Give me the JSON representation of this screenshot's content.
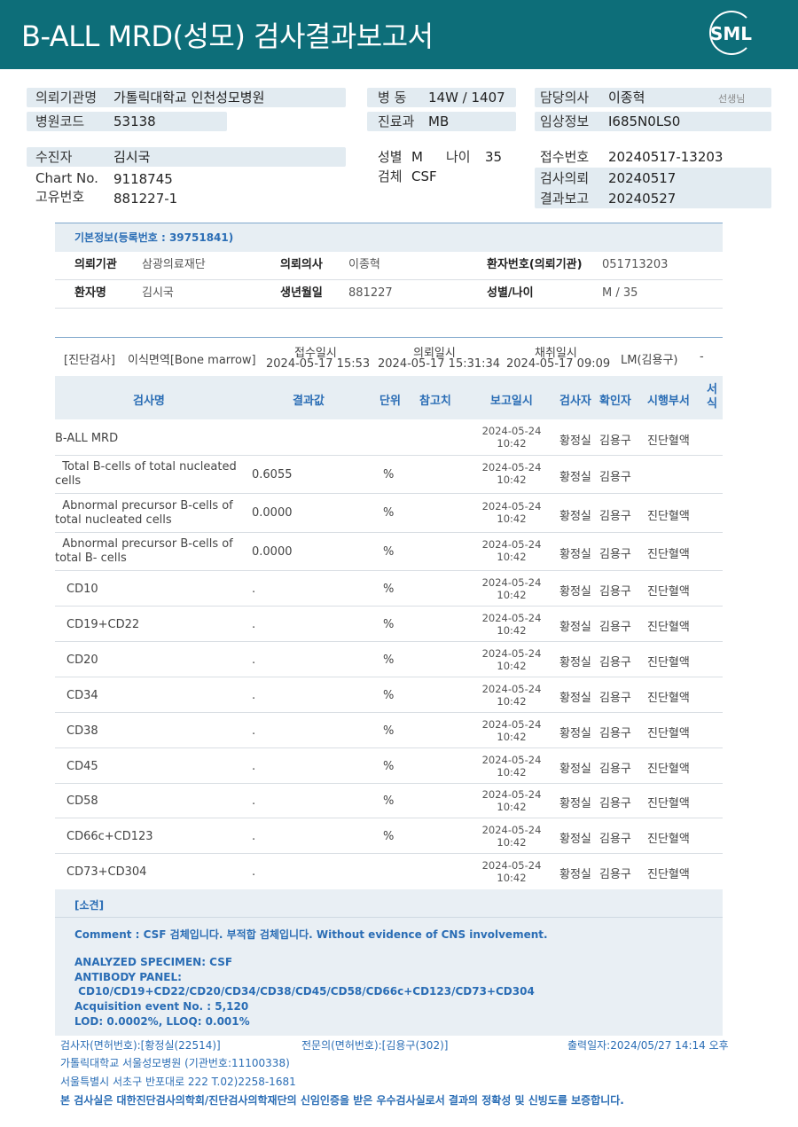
{
  "header": {
    "title": "B-ALL  MRD(성모) 검사결과보고서",
    "logo_text": "SML"
  },
  "request": {
    "institution_label": "의뢰기관명",
    "institution_value": "가톨릭대학교 인천성모병원",
    "hospital_code_label": "병원코드",
    "hospital_code_value": "53138",
    "ward_label": "병  동",
    "ward_value": "14W / 1407",
    "dept_label": "진료과",
    "dept_value": "MB",
    "doctor_label": "담당의사",
    "doctor_value": "이종혁",
    "doctor_suffix": "선생님",
    "clinical_label": "임상정보",
    "clinical_value": "I685N0LS0",
    "patient_label": "수진자",
    "patient_value": "김시국",
    "chart_label": "Chart No.",
    "chart_value": "9118745",
    "unique_label": "고유번호",
    "unique_value": "881227-1",
    "sex_label": "성별",
    "sex_value": "M",
    "age_label": "나이",
    "age_value": "35",
    "specimen_label": "검체",
    "specimen_value": "CSF",
    "receipt_label": "접수번호",
    "receipt_value": "20240517-13203",
    "request_date_label": "검사의뢰",
    "request_date_value": "20240517",
    "report_date_label": "결과보고",
    "report_date_value": "20240527"
  },
  "basic": {
    "title": "기본정보(등록번호 : 39751841)",
    "r1": {
      "l1": "의뢰기관",
      "v1": "삼광의료재단",
      "l2": "의뢰의사",
      "v2": "이종혁",
      "l3": "환자번호(의뢰기관)",
      "v3": "051713203"
    },
    "r2": {
      "l1": "환자명",
      "v1": "김시국",
      "l2": "생년월일",
      "v2": "881227",
      "l3": "성별/나이",
      "v3": "M / 35"
    }
  },
  "diag": {
    "category": "[진단검사]",
    "name": "이식면역[Bone marrow]",
    "receipt_label": "접수일시",
    "receipt_value": "2024-05-17 15:53",
    "request_label": "의뢰일시",
    "request_value": "2024-05-17 15:31:34",
    "collect_label": "채취일시",
    "collect_value": "2024-05-17 09:09",
    "lm": "LM(김용구)",
    "dash": "-"
  },
  "table": {
    "headers": {
      "name": "검사명",
      "result": "결과값",
      "unit": "단위",
      "ref": "참고치",
      "report": "보고일시",
      "tester": "검사자",
      "confirmer": "확인자",
      "dept": "시행부서",
      "format": "서\n식"
    },
    "rows": [
      {
        "name": "B-ALL MRD",
        "result": "",
        "unit": "",
        "date": "2024-05-24",
        "time": "10:42",
        "tester": "황정실",
        "confirmer": "김용구",
        "dept": "진단혈액"
      },
      {
        "name": "  Total B-cells of total nucleated cells",
        "result": "0.6055",
        "unit": "%",
        "date": "2024-05-24",
        "time": "10:42",
        "tester": "황정실",
        "confirmer": "김용구",
        "dept": ""
      },
      {
        "name": "  Abnormal precursor B-cells of total nucleated cells",
        "result": "0.0000",
        "unit": "%",
        "date": "2024-05-24",
        "time": "10:42",
        "tester": "황정실",
        "confirmer": "김용구",
        "dept": "진단혈액"
      },
      {
        "name": "  Abnormal precursor B-cells of total B- cells",
        "result": "0.0000",
        "unit": "%",
        "date": "2024-05-24",
        "time": "10:42",
        "tester": "황정실",
        "confirmer": "김용구",
        "dept": "진단혈액"
      },
      {
        "name": "CD10",
        "result": ".",
        "unit": "%",
        "date": "2024-05-24",
        "time": "10:42",
        "tester": "황정실",
        "confirmer": "김용구",
        "dept": "진단혈액"
      },
      {
        "name": "CD19+CD22",
        "result": ".",
        "unit": "%",
        "date": "2024-05-24",
        "time": "10:42",
        "tester": "황정실",
        "confirmer": "김용구",
        "dept": "진단혈액"
      },
      {
        "name": "CD20",
        "result": ".",
        "unit": "%",
        "date": "2024-05-24",
        "time": "10:42",
        "tester": "황정실",
        "confirmer": "김용구",
        "dept": "진단혈액"
      },
      {
        "name": "CD34",
        "result": ".",
        "unit": "%",
        "date": "2024-05-24",
        "time": "10:42",
        "tester": "황정실",
        "confirmer": "김용구",
        "dept": "진단혈액"
      },
      {
        "name": "CD38",
        "result": ".",
        "unit": "%",
        "date": "2024-05-24",
        "time": "10:42",
        "tester": "황정실",
        "confirmer": "김용구",
        "dept": "진단혈액"
      },
      {
        "name": "CD45",
        "result": ".",
        "unit": "%",
        "date": "2024-05-24",
        "time": "10:42",
        "tester": "황정실",
        "confirmer": "김용구",
        "dept": "진단혈액"
      },
      {
        "name": "CD58",
        "result": ".",
        "unit": "%",
        "date": "2024-05-24",
        "time": "10:42",
        "tester": "황정실",
        "confirmer": "김용구",
        "dept": "진단혈액"
      },
      {
        "name": "CD66c+CD123",
        "result": ".",
        "unit": "%",
        "date": "2024-05-24",
        "time": "10:42",
        "tester": "황정실",
        "confirmer": "김용구",
        "dept": "진단혈액"
      },
      {
        "name": "CD73+CD304",
        "result": ".",
        "unit": "",
        "date": "2024-05-24",
        "time": "10:42",
        "tester": "황정실",
        "confirmer": "김용구",
        "dept": "진단혈액"
      }
    ]
  },
  "remarks": {
    "title": "[소견]",
    "comment": "Comment : CSF 검체입니다. 부적합 검체입니다. Without evidence of CNS involvement.",
    "specimen": "ANALYZED SPECIMEN: CSF",
    "panel_label": "ANTIBODY PANEL:",
    "panel": " CD10/CD19+CD22/CD20/CD34/CD38/CD45/CD58/CD66c+CD123/CD73+CD304",
    "events": "Acquisition event No. : 5,120",
    "lod": "LOD: 0.0002%, LLOQ: 0.001%"
  },
  "footer": {
    "tester": "검사자(면허번호):[황정실(22514)]",
    "specialist": "전문의(면허번호):[김용구(302)]",
    "printed": "출력일자:2024/05/27 14:14 오후",
    "hospital": "가톨릭대학교 서울성모병원 (기관번호:11100338)",
    "address": "서울특별시 서초구 반포대로 222 T.02)2258-1681",
    "certification": "본 검사실은 대한진단검사의학회/진단검사의학재단의 신임인증을 받은 우수검사실로서 결과의 정확성 및 신빙도를 보증합니다."
  }
}
